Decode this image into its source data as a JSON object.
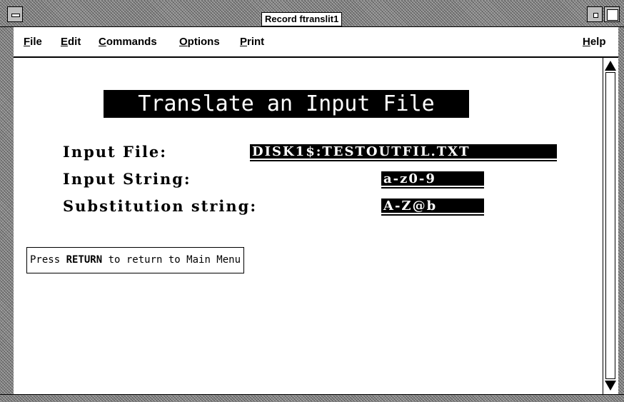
{
  "window": {
    "title": "Record ftranslit1"
  },
  "menubar": {
    "file": "File",
    "edit": "Edit",
    "commands": "Commands",
    "options": "Options",
    "print": "Print",
    "help": "Help"
  },
  "form": {
    "heading": "Translate an Input File",
    "input_file_label": "Input File:",
    "input_file_value": "DISK1$:TESTOUTFIL.TXT",
    "input_string_label": "Input String:",
    "input_string_value": "a-z0-9",
    "substitution_label": "Substitution string:",
    "substitution_value": "A-Z@b"
  },
  "status": {
    "prefix": "Press ",
    "key": "RETURN",
    "suffix": " to return to Main Menu"
  },
  "colors": {
    "background": "#ffffff",
    "foreground": "#000000",
    "frame": "#8c8c8c"
  }
}
